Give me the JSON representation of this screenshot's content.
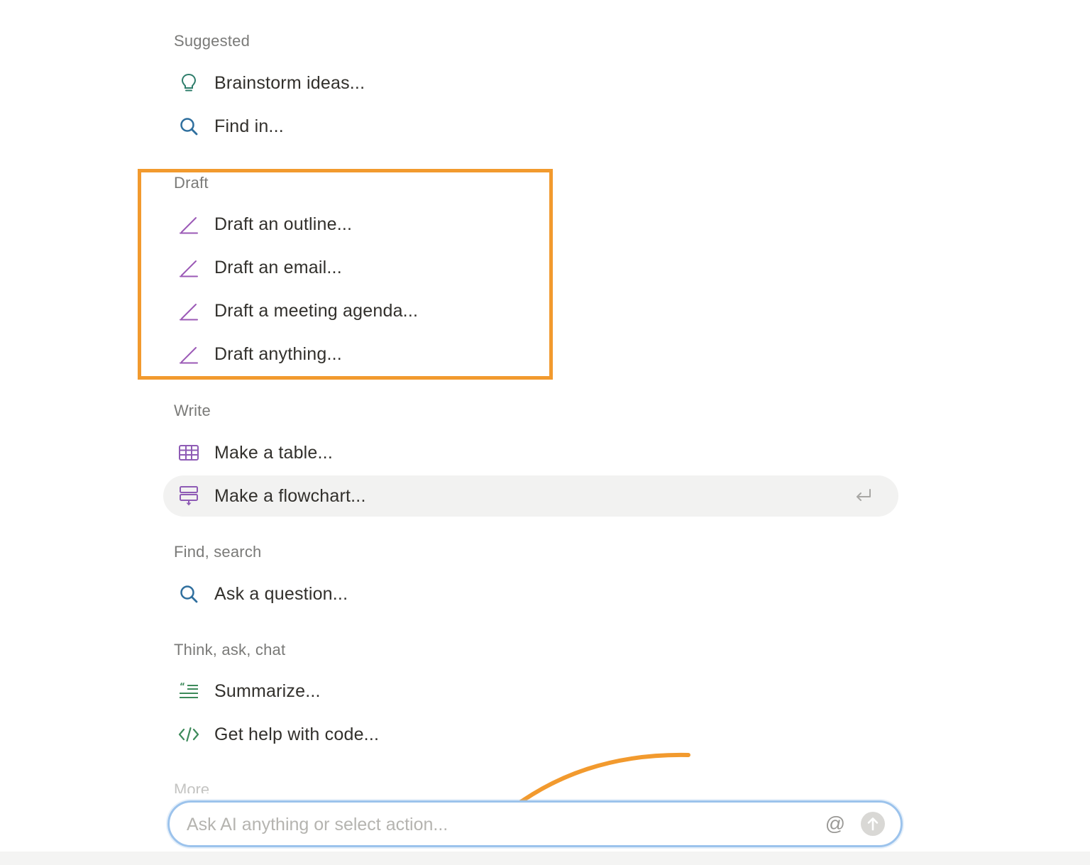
{
  "colors": {
    "highlight": "#f29a2e",
    "draft_icon": "#9b59b6",
    "search_icon": "#2f6f9e",
    "suggest_icon": "#2e7d6b",
    "write_icon": "#8e5bb5",
    "think_icon": "#3d8a5a"
  },
  "sections": [
    {
      "title": "Suggested",
      "items": [
        {
          "label": "Brainstorm ideas...",
          "icon": "lightbulb-icon"
        },
        {
          "label": "Find in...",
          "icon": "search-icon"
        }
      ]
    },
    {
      "title": "Draft",
      "items": [
        {
          "label": "Draft an outline...",
          "icon": "pen-icon"
        },
        {
          "label": "Draft an email...",
          "icon": "pen-icon"
        },
        {
          "label": "Draft a meeting agenda...",
          "icon": "pen-icon"
        },
        {
          "label": "Draft anything...",
          "icon": "pen-icon"
        }
      ]
    },
    {
      "title": "Write",
      "items": [
        {
          "label": "Make a table...",
          "icon": "table-icon"
        },
        {
          "label": "Make a flowchart...",
          "icon": "flowchart-icon",
          "active": true
        }
      ]
    },
    {
      "title": "Find, search",
      "items": [
        {
          "label": "Ask a question...",
          "icon": "search-icon"
        }
      ]
    },
    {
      "title": "Think, ask, chat",
      "items": [
        {
          "label": "Summarize...",
          "icon": "summarize-icon"
        },
        {
          "label": "Get help with code...",
          "icon": "code-icon"
        }
      ]
    }
  ],
  "more_title": "More",
  "ai_input": {
    "value": "",
    "placeholder": "Ask AI anything or select action...",
    "mention_symbol": "@"
  }
}
